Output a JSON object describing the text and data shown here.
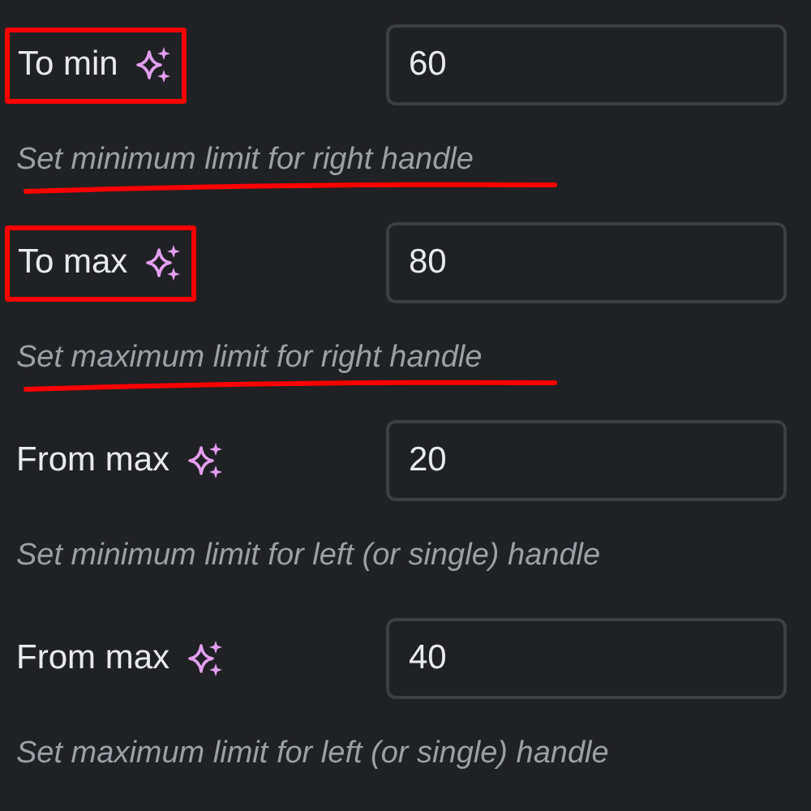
{
  "fields": [
    {
      "label": "To min",
      "value": "60",
      "hint": "Set minimum limit for right handle",
      "highlighted": true
    },
    {
      "label": "To max",
      "value": "80",
      "hint": "Set maximum limit for right handle",
      "highlighted": true
    },
    {
      "label": "From max",
      "value": "20",
      "hint": "Set minimum limit for left (or single) handle",
      "highlighted": false
    },
    {
      "label": "From max",
      "value": "40",
      "hint": "Set maximum limit for left (or single) handle",
      "highlighted": false
    }
  ]
}
